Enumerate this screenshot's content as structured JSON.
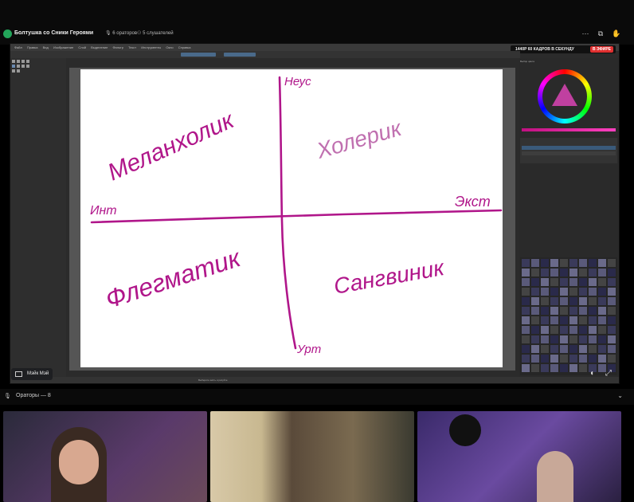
{
  "channel": {
    "title": "Болтушка со Сники Героями",
    "speakers_count": "6 ораторов",
    "listeners_count": "5 слушателей"
  },
  "stream": {
    "live_info": "1440P 60 КАДРОВ В СЕКУНДУ",
    "live_badge": "В ЭФИРЕ"
  },
  "app": {
    "menu": [
      "Файл",
      "Правка",
      "Вид",
      "Изображение",
      "Слой",
      "Выделение",
      "Фильтр",
      "Текст",
      "Инструменты",
      "Окно",
      "Справка"
    ],
    "canvas_tab": "Без названия",
    "docker_tab": "Выбор цвета",
    "status": "Выберите кисть и рисуйте"
  },
  "drawing": {
    "words": [
      "Меланхолик",
      "Холерик",
      "Флегматик",
      "Сангвиник",
      "Неус",
      "Инт",
      "Экст",
      "Урт"
    ],
    "stroke_color": "#b0168a"
  },
  "streamer": {
    "name": "Мэйк Мэй"
  },
  "speakers_panel": {
    "label": "Ораторы — 8"
  },
  "colors": {
    "accent": "#23a55a",
    "live_red": "#e03030",
    "ink": "#b0168a"
  }
}
